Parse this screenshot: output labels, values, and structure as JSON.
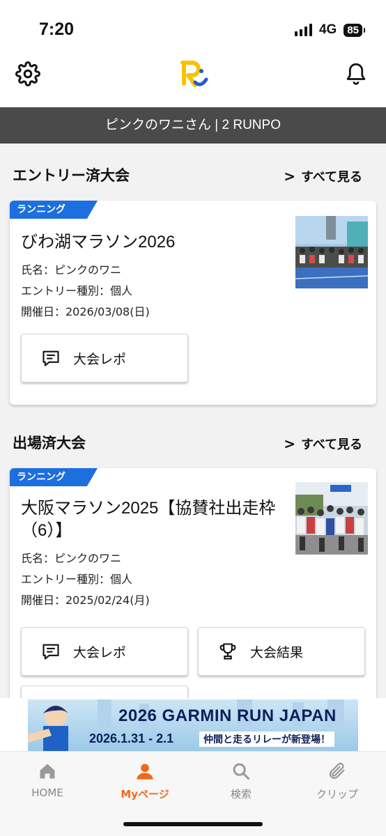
{
  "status_bar": {
    "time": "7:20",
    "network": "4G",
    "battery": "85"
  },
  "header": {
    "logo_icon": "runpo-logo-icon",
    "settings_icon": "gear-icon",
    "notification_icon": "bell-icon"
  },
  "user_bar": {
    "text": "ピンクのワニさん | 2 RUNPO"
  },
  "entry_section": {
    "title": "エントリー済大会",
    "see_all": "すべて見る",
    "card": {
      "tag": "ランニング",
      "title": "びわ湖マラソン2026",
      "name_line": "氏名：ピンクのワニ",
      "entry_type_line": "エントリー種別：個人",
      "date_line": "開催日：2026/03/08(日)",
      "report_button": "大会レポ"
    }
  },
  "participated_section": {
    "title": "出場済大会",
    "see_all": "すべて見る",
    "card": {
      "tag": "ランニング",
      "title_line1": "大阪マラソン2025【協賛社出走枠",
      "title_line2": "（6）】",
      "name_line": "氏名：ピンクのワニ",
      "entry_type_line": "エントリー種別：個人",
      "date_line": "開催日：2025/02/24(月)",
      "report_button": "大会レポ",
      "result_button": "大会結果"
    }
  },
  "banner": {
    "title": "2026 GARMIN RUN JAPAN",
    "dates": "2026.1.31 - 2.1",
    "note": "仲間と走るリレーが新登場！"
  },
  "tabbar": {
    "items": [
      {
        "label": "HOME",
        "icon": "home-icon"
      },
      {
        "label": "Myページ",
        "icon": "person-icon"
      },
      {
        "label": "検索",
        "icon": "search-icon"
      },
      {
        "label": "クリップ",
        "icon": "paperclip-icon"
      }
    ],
    "active_index": 1
  },
  "colors": {
    "accent": "#f06a1a",
    "tag": "#1d6fe0",
    "user_bar": "#4a4a4a"
  }
}
